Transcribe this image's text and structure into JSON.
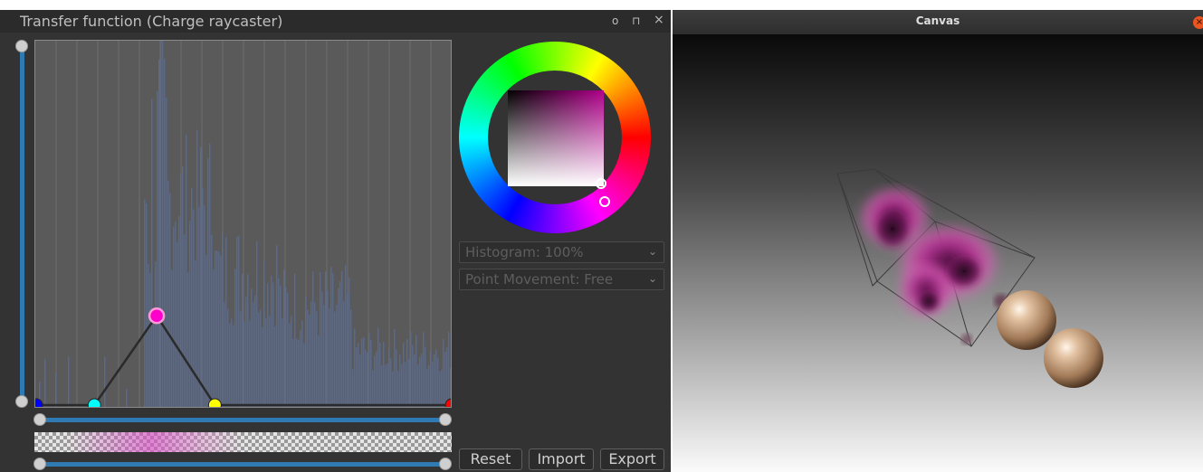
{
  "tf_panel": {
    "title": "Transfer function (Charge raycaster)",
    "histogram_dropdown": "Histogram: 100%",
    "movement_dropdown": "Point Movement: Free",
    "buttons": {
      "reset": "Reset",
      "import": "Import",
      "export": "Export"
    },
    "title_icons": {
      "float": "o",
      "pin": "⊓",
      "close": "×"
    },
    "control_points": [
      {
        "color": "#0000ff",
        "pos": 0.0,
        "alpha": 0.0
      },
      {
        "color": "#00ffff",
        "pos": 0.14,
        "alpha": 0.0
      },
      {
        "color": "#ff00cc",
        "pos": 0.29,
        "alpha": 0.07
      },
      {
        "color": "#ffff00",
        "pos": 0.43,
        "alpha": 0.0
      },
      {
        "color": "#ff0000",
        "pos": 1.0,
        "alpha": 0.0
      }
    ],
    "selected_color": "#c8009a",
    "histogram_color": "#4f6fb0"
  },
  "canvas_window": {
    "title": "Canvas",
    "close_icon": "×"
  }
}
